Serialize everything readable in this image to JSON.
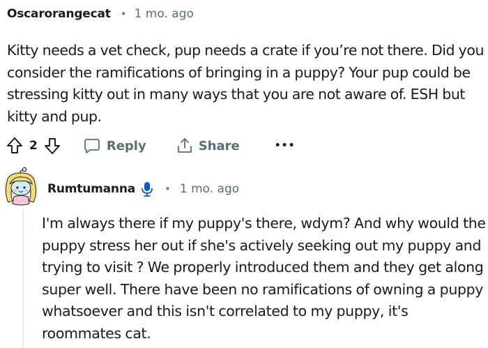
{
  "comment1": {
    "author": "Oscarorangecat",
    "separator": "•",
    "time": "1 mo. ago",
    "body": "Kitty needs a vet check, pup needs a crate if you’re not there. Did you consider the ramifications of bringing in a puppy? Your pup could be stressing kitty out in many ways that you are not aware of. ESH but kitty and pup.",
    "actions": {
      "vote_count": "2",
      "reply_label": "Reply",
      "share_label": "Share",
      "more_label": "•••"
    }
  },
  "comment2": {
    "author": "Rumtumanna",
    "separator": "•",
    "time": "1 mo. ago",
    "body": "I'm always there if my puppy's there, wdym? And why would the puppy stress her out if she's actively seeking out my puppy and trying to visit ? We properly introduced them and they get along super well. There have been no ramifications of owning a puppy whatsoever and this isn't correlated to my puppy, it's roommates cat."
  },
  "icons": {
    "upvote": "upvote-icon",
    "downvote": "downvote-icon",
    "reply": "chat-bubble-icon",
    "share": "share-icon",
    "mic": "microphone-icon",
    "avatar": "snoo-avatar"
  },
  "colors": {
    "meta_text": "#576f76",
    "body_text": "#1a1a1b",
    "mic_blue": "#0a5bd3",
    "thread_line": "#e5ebee"
  }
}
